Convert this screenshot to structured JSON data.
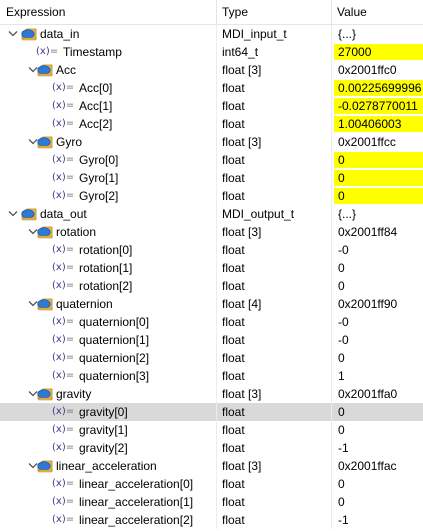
{
  "header": {
    "col_expression": "Expression",
    "col_type": "Type",
    "col_value": "Value"
  },
  "rows": [
    {
      "name": "data_in",
      "type": "MDI_input_t",
      "value": "{...}",
      "level": 0,
      "kind": "struct",
      "expanded": true,
      "changed": false
    },
    {
      "name": "Timestamp",
      "type": "int64_t",
      "value": "27000",
      "level": 1,
      "kind": "var",
      "changed": true
    },
    {
      "name": "Acc",
      "type": "float [3]",
      "value": "0x2001ffc0",
      "level": 1,
      "kind": "struct",
      "expanded": true,
      "changed": false
    },
    {
      "name": "Acc[0]",
      "type": "float",
      "value": "0.00225699996",
      "level": 2,
      "kind": "var",
      "changed": true
    },
    {
      "name": "Acc[1]",
      "type": "float",
      "value": "-0.0278770011",
      "level": 2,
      "kind": "var",
      "changed": true
    },
    {
      "name": "Acc[2]",
      "type": "float",
      "value": "1.00406003",
      "level": 2,
      "kind": "var",
      "changed": true
    },
    {
      "name": "Gyro",
      "type": "float [3]",
      "value": "0x2001ffcc",
      "level": 1,
      "kind": "struct",
      "expanded": true,
      "changed": false
    },
    {
      "name": "Gyro[0]",
      "type": "float",
      "value": "0",
      "level": 2,
      "kind": "var",
      "changed": true
    },
    {
      "name": "Gyro[1]",
      "type": "float",
      "value": "0",
      "level": 2,
      "kind": "var",
      "changed": true
    },
    {
      "name": "Gyro[2]",
      "type": "float",
      "value": "0",
      "level": 2,
      "kind": "var",
      "changed": true
    },
    {
      "name": "data_out",
      "type": "MDI_output_t",
      "value": "{...}",
      "level": 0,
      "kind": "struct",
      "expanded": true,
      "changed": false
    },
    {
      "name": "rotation",
      "type": "float [3]",
      "value": "0x2001ff84",
      "level": 1,
      "kind": "struct",
      "expanded": true,
      "changed": false
    },
    {
      "name": "rotation[0]",
      "type": "float",
      "value": "-0",
      "level": 2,
      "kind": "var",
      "changed": false
    },
    {
      "name": "rotation[1]",
      "type": "float",
      "value": "0",
      "level": 2,
      "kind": "var",
      "changed": false
    },
    {
      "name": "rotation[2]",
      "type": "float",
      "value": "0",
      "level": 2,
      "kind": "var",
      "changed": false
    },
    {
      "name": "quaternion",
      "type": "float [4]",
      "value": "0x2001ff90",
      "level": 1,
      "kind": "struct",
      "expanded": true,
      "changed": false
    },
    {
      "name": "quaternion[0]",
      "type": "float",
      "value": "-0",
      "level": 2,
      "kind": "var",
      "changed": false
    },
    {
      "name": "quaternion[1]",
      "type": "float",
      "value": "-0",
      "level": 2,
      "kind": "var",
      "changed": false
    },
    {
      "name": "quaternion[2]",
      "type": "float",
      "value": "0",
      "level": 2,
      "kind": "var",
      "changed": false
    },
    {
      "name": "quaternion[3]",
      "type": "float",
      "value": "1",
      "level": 2,
      "kind": "var",
      "changed": false
    },
    {
      "name": "gravity",
      "type": "float [3]",
      "value": "0x2001ffa0",
      "level": 1,
      "kind": "struct",
      "expanded": true,
      "changed": false
    },
    {
      "name": "gravity[0]",
      "type": "float",
      "value": "0",
      "level": 2,
      "kind": "var",
      "changed": false,
      "selected": true
    },
    {
      "name": "gravity[1]",
      "type": "float",
      "value": "0",
      "level": 2,
      "kind": "var",
      "changed": false
    },
    {
      "name": "gravity[2]",
      "type": "float",
      "value": "-1",
      "level": 2,
      "kind": "var",
      "changed": false
    },
    {
      "name": "linear_acceleration",
      "type": "float [3]",
      "value": "0x2001ffac",
      "level": 1,
      "kind": "struct",
      "expanded": true,
      "changed": false
    },
    {
      "name": "linear_acceleration[0]",
      "type": "float",
      "value": "0",
      "level": 2,
      "kind": "var",
      "changed": false
    },
    {
      "name": "linear_acceleration[1]",
      "type": "float",
      "value": "0",
      "level": 2,
      "kind": "var",
      "changed": false
    },
    {
      "name": "linear_acceleration[2]",
      "type": "float",
      "value": "-1",
      "level": 2,
      "kind": "var",
      "changed": false
    }
  ],
  "icons": {
    "struct": "struct-icon",
    "var": "variable-icon",
    "var_glyph_x": "(x)",
    "var_glyph_eq": "=",
    "expanded": "chevron-down-icon"
  },
  "colors": {
    "changed_value_bg": "#ffff00",
    "selected_row_bg": "#d9d9d9",
    "struct_icon_blue": "#2b7bd6",
    "struct_icon_folder": "#e8b84a"
  }
}
